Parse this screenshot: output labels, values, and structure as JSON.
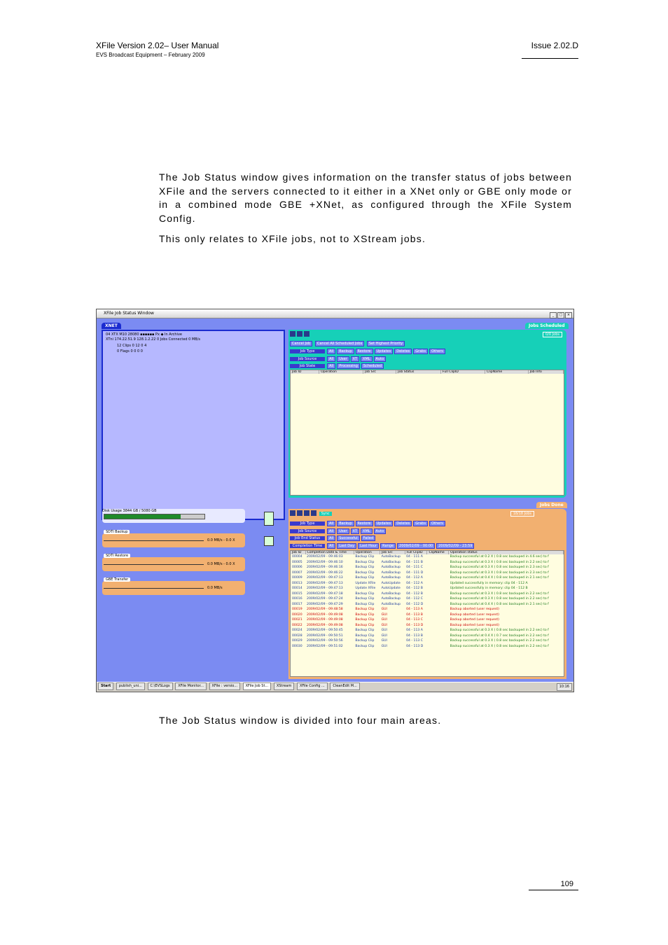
{
  "header": {
    "title": "XFile Version 2.02– User Manual",
    "subtitle": "EVS Broadcast Equipment – February 2009",
    "issue": "Issue 2.02.D"
  },
  "body": {
    "intro": "The Job Status window gives information on the transfer status of jobs between XFile and the servers connected to it either in a XNet only or GBE only mode or in a combined mode GBE +XNet, as configured through the XFile System Config.",
    "note": "This only relates to XFile jobs, not to XStream jobs.",
    "after": "The Job Status window is divided into four main areas."
  },
  "page_number": "109",
  "screenshot": {
    "window_title": "XFile Job Status Window",
    "xnet_tag": "XNET",
    "xnet_rows": [
      "04 XTX M10     28080   ▪▪▪▪▪▪ Px ◆   In Archive",
      "XTni    174.22.51.9     128.1.2.22     0 Jobs Connected     0 MB/s",
      "12 Clips   0   12   0   4",
      "0 Flags   0   0   0   0"
    ],
    "sched_tag": "Jobs Scheduled",
    "sched_count": "0/0 Jobs",
    "sched_actions": [
      "Cancel Job",
      "Cancel All Scheduled Jobs",
      "Set Highest Priority"
    ],
    "sched_filters": [
      {
        "label": "Job Type",
        "opts": [
          "All",
          "Backup",
          "Restore",
          "Updates",
          "Deletes",
          "Grabs",
          "Others"
        ]
      },
      {
        "label": "Job Source",
        "opts": [
          "All",
          "User",
          "XT",
          "XML",
          "Auto"
        ]
      },
      {
        "label": "Job State",
        "opts": [
          "All",
          "Processing",
          "Scheduled"
        ]
      }
    ],
    "sched_columns": [
      "Job ID",
      "Operation",
      "Job Src",
      "Job Status",
      "Full ClipID",
      "ClipName",
      "Job Info"
    ],
    "done_tag": "Jobs Done",
    "done_count": "18/18 Jobs",
    "sync_label": "Sync",
    "done_filters": [
      {
        "label": "Job Type",
        "opts": [
          "All",
          "Backup",
          "Restore",
          "Updates",
          "Deletes",
          "Grabs",
          "Others"
        ]
      },
      {
        "label": "Job Source",
        "opts": [
          "All",
          "User",
          "XT",
          "XML",
          "Auto"
        ]
      },
      {
        "label": "Job End Status",
        "opts": [
          "All",
          "Successful",
          "Failed"
        ]
      },
      {
        "label": "Completion Time",
        "opts": [
          "All",
          "Last Day",
          "Last Hour",
          "Range",
          "2009/02/09 - 00:00",
          "2009/02/09 - 23:59"
        ]
      }
    ],
    "done_columns": [
      "Job ID",
      "Completion Date & Time",
      "Operation",
      "Job Src",
      "Full ClipID",
      "ClipName",
      "Operation status"
    ],
    "done_rows": [
      [
        "00004",
        "2009/02/09 - 09:46:03",
        "Backup Clip",
        "AutoBackup",
        "04 - 111 A",
        "",
        "Backup successful at 0.2 X ( 0.8 sec backuped in 4.6 sec) to f"
      ],
      [
        "00005",
        "2009/02/09 - 09:46:10",
        "Backup Clip",
        "AutoBackup",
        "04 - 111 B",
        "",
        "Backup successful at 0.3 X ( 0.8 sec backuped in 2.2 sec) to f"
      ],
      [
        "00006",
        "2009/02/09 - 09:46:16",
        "Backup Clip",
        "AutoBackup",
        "04 - 111 C",
        "",
        "Backup successful at 0.3 X ( 0.8 sec backuped in 2.3 sec) to f"
      ],
      [
        "00007",
        "2009/02/09 - 09:46:22",
        "Backup Clip",
        "AutoBackup",
        "04 - 111 D",
        "",
        "Backup successful at 0.3 X ( 0.8 sec backuped in 2.3 sec) to f"
      ],
      [
        "00009",
        "2009/02/09 - 09:47:13",
        "Backup Clip",
        "AutoBackup",
        "04 - 112 A",
        "",
        "Backup successful at 0.4 X ( 0.8 sec backuped in 2.1 sec) to f"
      ],
      [
        "00013",
        "2009/02/09 - 09:47:13",
        "Update XFile",
        "AutoUpdate",
        "04 - 112 A",
        "",
        "Updated successfully in memory: clip 04 - 112 A"
      ],
      [
        "00014",
        "2009/02/09 - 09:47:13",
        "Update XFile",
        "AutoUpdate",
        "04 - 112 B",
        "",
        "Updated successfully in memory: clip 04 - 112 B"
      ],
      [
        "00015",
        "2009/02/09 - 09:47:18",
        "Backup Clip",
        "AutoBackup",
        "04 - 112 B",
        "",
        "Backup successful at 0.3 X ( 0.8 sec backuped in 2.2 sec) to f"
      ],
      [
        "00016",
        "2009/02/09 - 09:47:24",
        "Backup Clip",
        "AutoBackup",
        "04 - 112 C",
        "",
        "Backup successful at 0.3 X ( 0.8 sec backuped in 2.2 sec) to f"
      ],
      [
        "00017",
        "2009/02/09 - 09:47:29",
        "Backup Clip",
        "AutoBackup",
        "04 - 112 D",
        "",
        "Backup successful at 0.4 X ( 0.8 sec backuped in 2.1 sec) to f"
      ],
      [
        "00019",
        "2009/02/09 - 09:48:58",
        "Backup Clip",
        "GUI",
        "04 - 113 A",
        "",
        "Backup aborted (user request)"
      ],
      [
        "00020",
        "2009/02/09 - 09:49:08",
        "Backup Clip",
        "GUI",
        "04 - 113 B",
        "",
        "Backup aborted (user request)"
      ],
      [
        "00021",
        "2009/02/09 - 09:49:08",
        "Backup Clip",
        "GUI",
        "04 - 113 C",
        "",
        "Backup aborted (user request)"
      ],
      [
        "00022",
        "2009/02/09 - 09:49:08",
        "Backup Clip",
        "GUI",
        "04 - 113 D",
        "",
        "Backup aborted (user request)"
      ],
      [
        "00024",
        "2009/02/09 - 09:50:45",
        "Backup Clip",
        "GUI",
        "04 - 113 A",
        "",
        "Backup successful at 0.3 X ( 0.8 sec backuped in 2.2 sec) to f"
      ],
      [
        "00028",
        "2009/02/09 - 09:50:51",
        "Backup Clip",
        "GUI",
        "04 - 113 B",
        "",
        "Backup successful at 0.4 X ( 0.7 sec backuped in 2.2 sec) to f"
      ],
      [
        "00029",
        "2009/02/09 - 09:50:56",
        "Backup Clip",
        "GUI",
        "04 - 113 C",
        "",
        "Backup successful at 0.3 X ( 0.8 sec backuped in 2.2 sec) to f"
      ],
      [
        "00030",
        "2009/02/09 - 09:51:02",
        "Backup Clip",
        "GUI",
        "04 - 113 D",
        "",
        "Backup successful at 0.3 X ( 0.8 sec backuped in 2.2 sec) to f"
      ]
    ],
    "disk_label": "Disk Usage",
    "disk_value": "3844 GB / 5080 GB",
    "disk_fraction": 0.76,
    "gauges": [
      {
        "label": "SDTI Backup",
        "value": "0.0 MB/s - 0.0 X"
      },
      {
        "label": "SDTI Restore",
        "value": "0.0 MB/s - 0.0 X"
      },
      {
        "label": "GBE Transfer",
        "value": "0.0 MB/s"
      }
    ],
    "taskbar": [
      "Start",
      "publish_uni...",
      "C:\\EVSLogs",
      "XFile Monitor...",
      "XFile : versio...",
      "XFile Job St...",
      "XStream",
      "XFile Config ...",
      "CleanEdit M...",
      "10:16"
    ],
    "colors": {
      "background": "#7b8bf2",
      "scheduled": "#16d0b8",
      "done": "#f2b070",
      "xnet_panel": "#b6b8ff"
    }
  }
}
